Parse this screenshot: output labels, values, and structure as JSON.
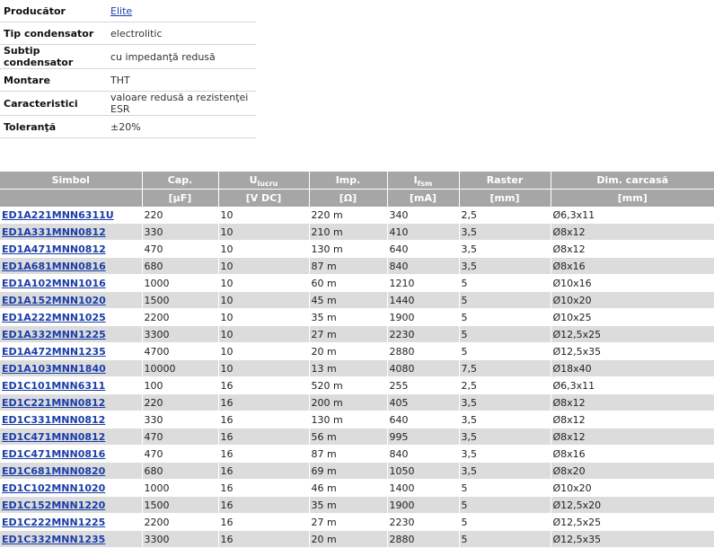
{
  "attributes": [
    {
      "label": "Producător",
      "value": "Elite",
      "link": true
    },
    {
      "label": "Tip condensator",
      "value": "electrolitic",
      "link": false
    },
    {
      "label": "Subtip condensator",
      "value": "cu impedanţă redusă",
      "link": false
    },
    {
      "label": "Montare",
      "value": "THT",
      "link": false
    },
    {
      "label": "Caracteristici",
      "value": "valoare redusă a rezistenţei ESR",
      "link": false
    },
    {
      "label": "Toleranţă",
      "value": "±20%",
      "link": false
    }
  ],
  "table": {
    "headers": [
      {
        "main": "Simbol",
        "sub": "",
        "unit": ""
      },
      {
        "main": "Cap.",
        "sub": "",
        "unit": "[µF]"
      },
      {
        "main": "U",
        "sub": "lucru",
        "unit": "[V DC]"
      },
      {
        "main": "Imp.",
        "sub": "",
        "unit": "[Ω]"
      },
      {
        "main": "I",
        "sub": "fsm",
        "unit": "[mA]"
      },
      {
        "main": "Raster",
        "sub": "",
        "unit": "[mm]"
      },
      {
        "main": "Dim. carcasă",
        "sub": "",
        "unit": "[mm]"
      }
    ],
    "rows": [
      [
        "ED1A221MNN6311U",
        "220",
        "10",
        "220 m",
        "340",
        "2,5",
        "Ø6,3x11"
      ],
      [
        "ED1A331MNN0812",
        "330",
        "10",
        "210 m",
        "410",
        "3,5",
        "Ø8x12"
      ],
      [
        "ED1A471MNN0812",
        "470",
        "10",
        "130 m",
        "640",
        "3,5",
        "Ø8x12"
      ],
      [
        "ED1A681MNN0816",
        "680",
        "10",
        "87 m",
        "840",
        "3,5",
        "Ø8x16"
      ],
      [
        "ED1A102MNN1016",
        "1000",
        "10",
        "60 m",
        "1210",
        "5",
        "Ø10x16"
      ],
      [
        "ED1A152MNN1020",
        "1500",
        "10",
        "45 m",
        "1440",
        "5",
        "Ø10x20"
      ],
      [
        "ED1A222MNN1025",
        "2200",
        "10",
        "35 m",
        "1900",
        "5",
        "Ø10x25"
      ],
      [
        "ED1A332MNN1225",
        "3300",
        "10",
        "27 m",
        "2230",
        "5",
        "Ø12,5x25"
      ],
      [
        "ED1A472MNN1235",
        "4700",
        "10",
        "20 m",
        "2880",
        "5",
        "Ø12,5x35"
      ],
      [
        "ED1A103MNN1840",
        "10000",
        "10",
        "13 m",
        "4080",
        "7,5",
        "Ø18x40"
      ],
      [
        "ED1C101MNN6311",
        "100",
        "16",
        "520 m",
        "255",
        "2,5",
        "Ø6,3x11"
      ],
      [
        "ED1C221MNN0812",
        "220",
        "16",
        "200 m",
        "405",
        "3,5",
        "Ø8x12"
      ],
      [
        "ED1C331MNN0812",
        "330",
        "16",
        "130 m",
        "640",
        "3,5",
        "Ø8x12"
      ],
      [
        "ED1C471MNN0812",
        "470",
        "16",
        "56 m",
        "995",
        "3,5",
        "Ø8x12"
      ],
      [
        "ED1C471MNN0816",
        "470",
        "16",
        "87 m",
        "840",
        "3,5",
        "Ø8x16"
      ],
      [
        "ED1C681MNN0820",
        "680",
        "16",
        "69 m",
        "1050",
        "3,5",
        "Ø8x20"
      ],
      [
        "ED1C102MNN1020",
        "1000",
        "16",
        "46 m",
        "1400",
        "5",
        "Ø10x20"
      ],
      [
        "ED1C152MNN1220",
        "1500",
        "16",
        "35 m",
        "1900",
        "5",
        "Ø12,5x20"
      ],
      [
        "ED1C222MNN1225",
        "2200",
        "16",
        "27 m",
        "2230",
        "5",
        "Ø12,5x25"
      ],
      [
        "ED1C332MNN1235",
        "3300",
        "16",
        "20 m",
        "2880",
        "5",
        "Ø12,5x35"
      ]
    ]
  }
}
